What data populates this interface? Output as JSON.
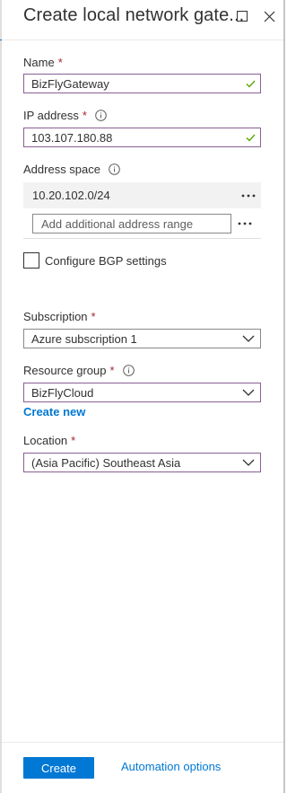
{
  "blade": {
    "title": "Create local network gate..."
  },
  "form": {
    "name": {
      "label": "Name",
      "required": "*",
      "value": "BizFlyGateway"
    },
    "ip_address": {
      "label": "IP address",
      "required": "*",
      "value": "103.107.180.88"
    },
    "address_space": {
      "label": "Address space",
      "ranges": [
        "10.20.102.0/24"
      ],
      "add_placeholder": "Add additional address range"
    },
    "bgp": {
      "label": "Configure BGP settings",
      "checked": false
    },
    "subscription": {
      "label": "Subscription",
      "required": "*",
      "value": "Azure subscription 1"
    },
    "resource_group": {
      "label": "Resource group",
      "required": "*",
      "value": "BizFlyCloud",
      "create_new_label": "Create new"
    },
    "location": {
      "label": "Location",
      "required": "*",
      "value": "(Asia Pacific) Southeast Asia"
    }
  },
  "footer": {
    "create_label": "Create",
    "automation_label": "Automation options"
  },
  "colors": {
    "accent": "#0078d4",
    "required": "#a4262c",
    "valid_check": "#57a300",
    "focused_border": "#8a5f93"
  },
  "icons": {
    "maximize": "maximize-icon",
    "close": "close-icon",
    "info": "info-icon",
    "valid": "checkmark-icon",
    "more": "more-options-icon",
    "dropdown": "chevron-down-icon"
  }
}
